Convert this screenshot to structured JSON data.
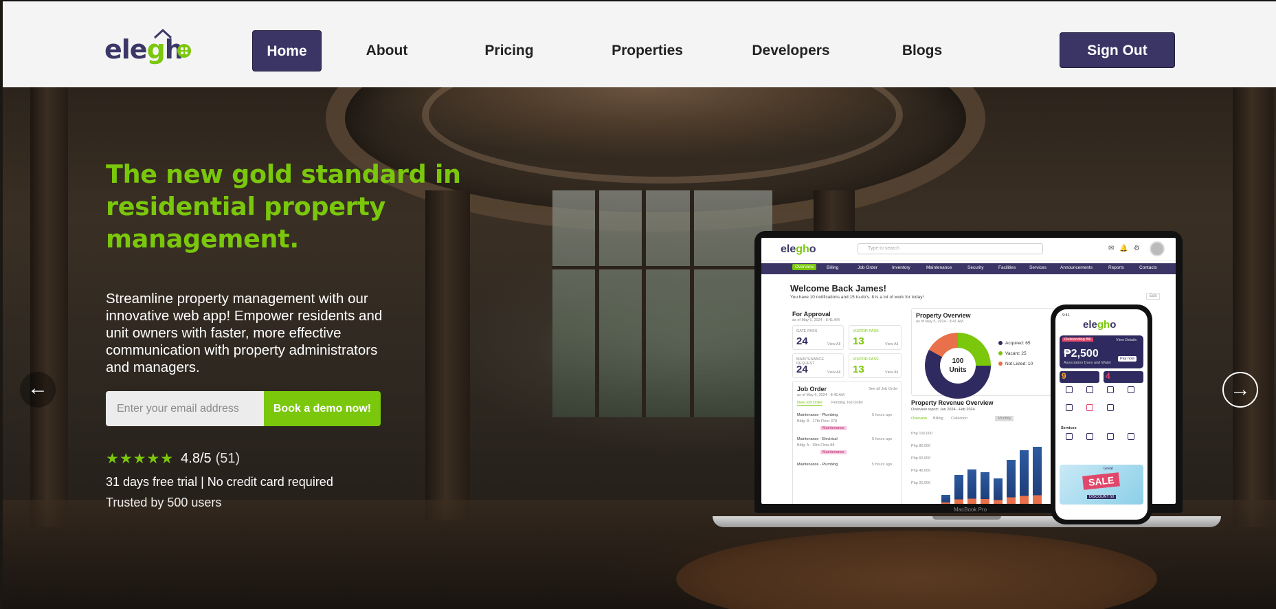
{
  "brand": {
    "logo_text_a": "ele",
    "logo_text_b": "g",
    "logo_text_c": "h",
    "logo_text_d": "o",
    "accent": "#7ac70c",
    "primary": "#3a3565"
  },
  "nav": {
    "items": [
      {
        "label": "Home",
        "active": true
      },
      {
        "label": "About"
      },
      {
        "label": "Pricing"
      },
      {
        "label": "Properties"
      },
      {
        "label": "Developers"
      },
      {
        "label": "Blogs"
      }
    ],
    "sign_out": "Sign Out"
  },
  "hero": {
    "headline": "The new gold standard in residential property management.",
    "subtext": "Streamline property management with our innovative web app! Empower residents and unit owners with faster, more effective communication with property administrators and managers.",
    "email_placeholder": "Enter your email address",
    "cta": "Book a demo now!",
    "stars": "★★★★★",
    "rating_value": "4.8/5",
    "rating_count": "(51)",
    "trial": "31 days free trial | No credit card required",
    "trusted": "Trusted by 500 users",
    "prev_arrow": "←",
    "next_arrow": "→"
  },
  "laptop_screen": {
    "logo_a": "ele",
    "logo_b": "gh",
    "logo_c": "o",
    "search_placeholder": "Type to search",
    "menu": [
      "Overview",
      "Billing",
      "Job Order",
      "Inventory",
      "Maintenance",
      "Security",
      "Facilities",
      "Services",
      "Announcements",
      "Reports",
      "Contacts"
    ],
    "welcome": "Welcome Back James!",
    "welcome_sub": "You have 10 notifications and 15 to-do's. It is a lot of work for today!",
    "edit": "Edit",
    "approval": {
      "title": "For Approval",
      "date": "as of May 6, 2024 - 8:41 AM",
      "cards": [
        {
          "label": "GATE PASS",
          "value": "24",
          "link": "View All",
          "color": "#2f2b60"
        },
        {
          "label": "VISITOR PASS",
          "value": "13",
          "link": "View All",
          "color": "#7ac70c"
        },
        {
          "label": "MAINTENANCE REQUEST",
          "value": "24",
          "link": "View All",
          "color": "#2f2b60"
        },
        {
          "label": "VISITOR PASS",
          "value": "13",
          "link": "View All",
          "color": "#7ac70c"
        }
      ]
    },
    "job_order": {
      "title": "Job Order",
      "date": "as of May 6, 2024 - 8:45 AM",
      "see_all": "See all Job Order",
      "tabs": [
        "New Job Order",
        "Pending Job Order"
      ],
      "items": [
        {
          "title": "Maintenance - Plumbing",
          "sub": "Bldg. B - 17th Floor 378",
          "time": "5 hours ago",
          "tag": "Maintenance"
        },
        {
          "title": "Maintenance - Electrical",
          "sub": "Bldg. A - 15th Floor 88",
          "time": "5 hours ago",
          "tag": "Maintenance"
        },
        {
          "title": "Maintenance - Plumbing",
          "sub": "",
          "time": "5 hours ago",
          "tag": ""
        }
      ]
    },
    "overview": {
      "title": "Property Overview",
      "date": "as of May 5, 2024 - 8:41 AM",
      "center_value": "100",
      "center_label": "Units",
      "legend": [
        {
          "label": "Acquired: 65",
          "color": "#2f2b60"
        },
        {
          "label": "Vacant: 25",
          "color": "#7ac70c"
        },
        {
          "label": "Not Listed: 10",
          "color": "#e8704a"
        }
      ]
    },
    "revenue": {
      "title": "Property Revenue Overview",
      "sub": "Overview report: Jan 2024 - Feb 2024",
      "tabs": [
        "Overview",
        "Billing",
        "Collection"
      ],
      "period": "Monthly",
      "y_labels": [
        "Php 100,000",
        "Php 80,000",
        "Php 60,000",
        "Php 40,000",
        "Php 20,000"
      ],
      "bars": [
        0.12,
        0.38,
        0.45,
        0.41,
        0.33,
        0.58,
        0.7,
        0.75
      ]
    },
    "brand_under": "MacBook Pro"
  },
  "phone_screen": {
    "time": "9:41",
    "logo_a": "ele",
    "logo_b": "gh",
    "logo_c": "o",
    "card_tag": "Outstanding Bill",
    "view_details": "View Details",
    "amount": "₱2,500",
    "card_sub": "Association Dues and Water",
    "pay_now": "Pay now",
    "stat1": "9",
    "stat2": "4",
    "services_title": "Services",
    "sale_top": "Great",
    "sale": "SALE",
    "sale_bottom": "DISCOUNT 50"
  }
}
